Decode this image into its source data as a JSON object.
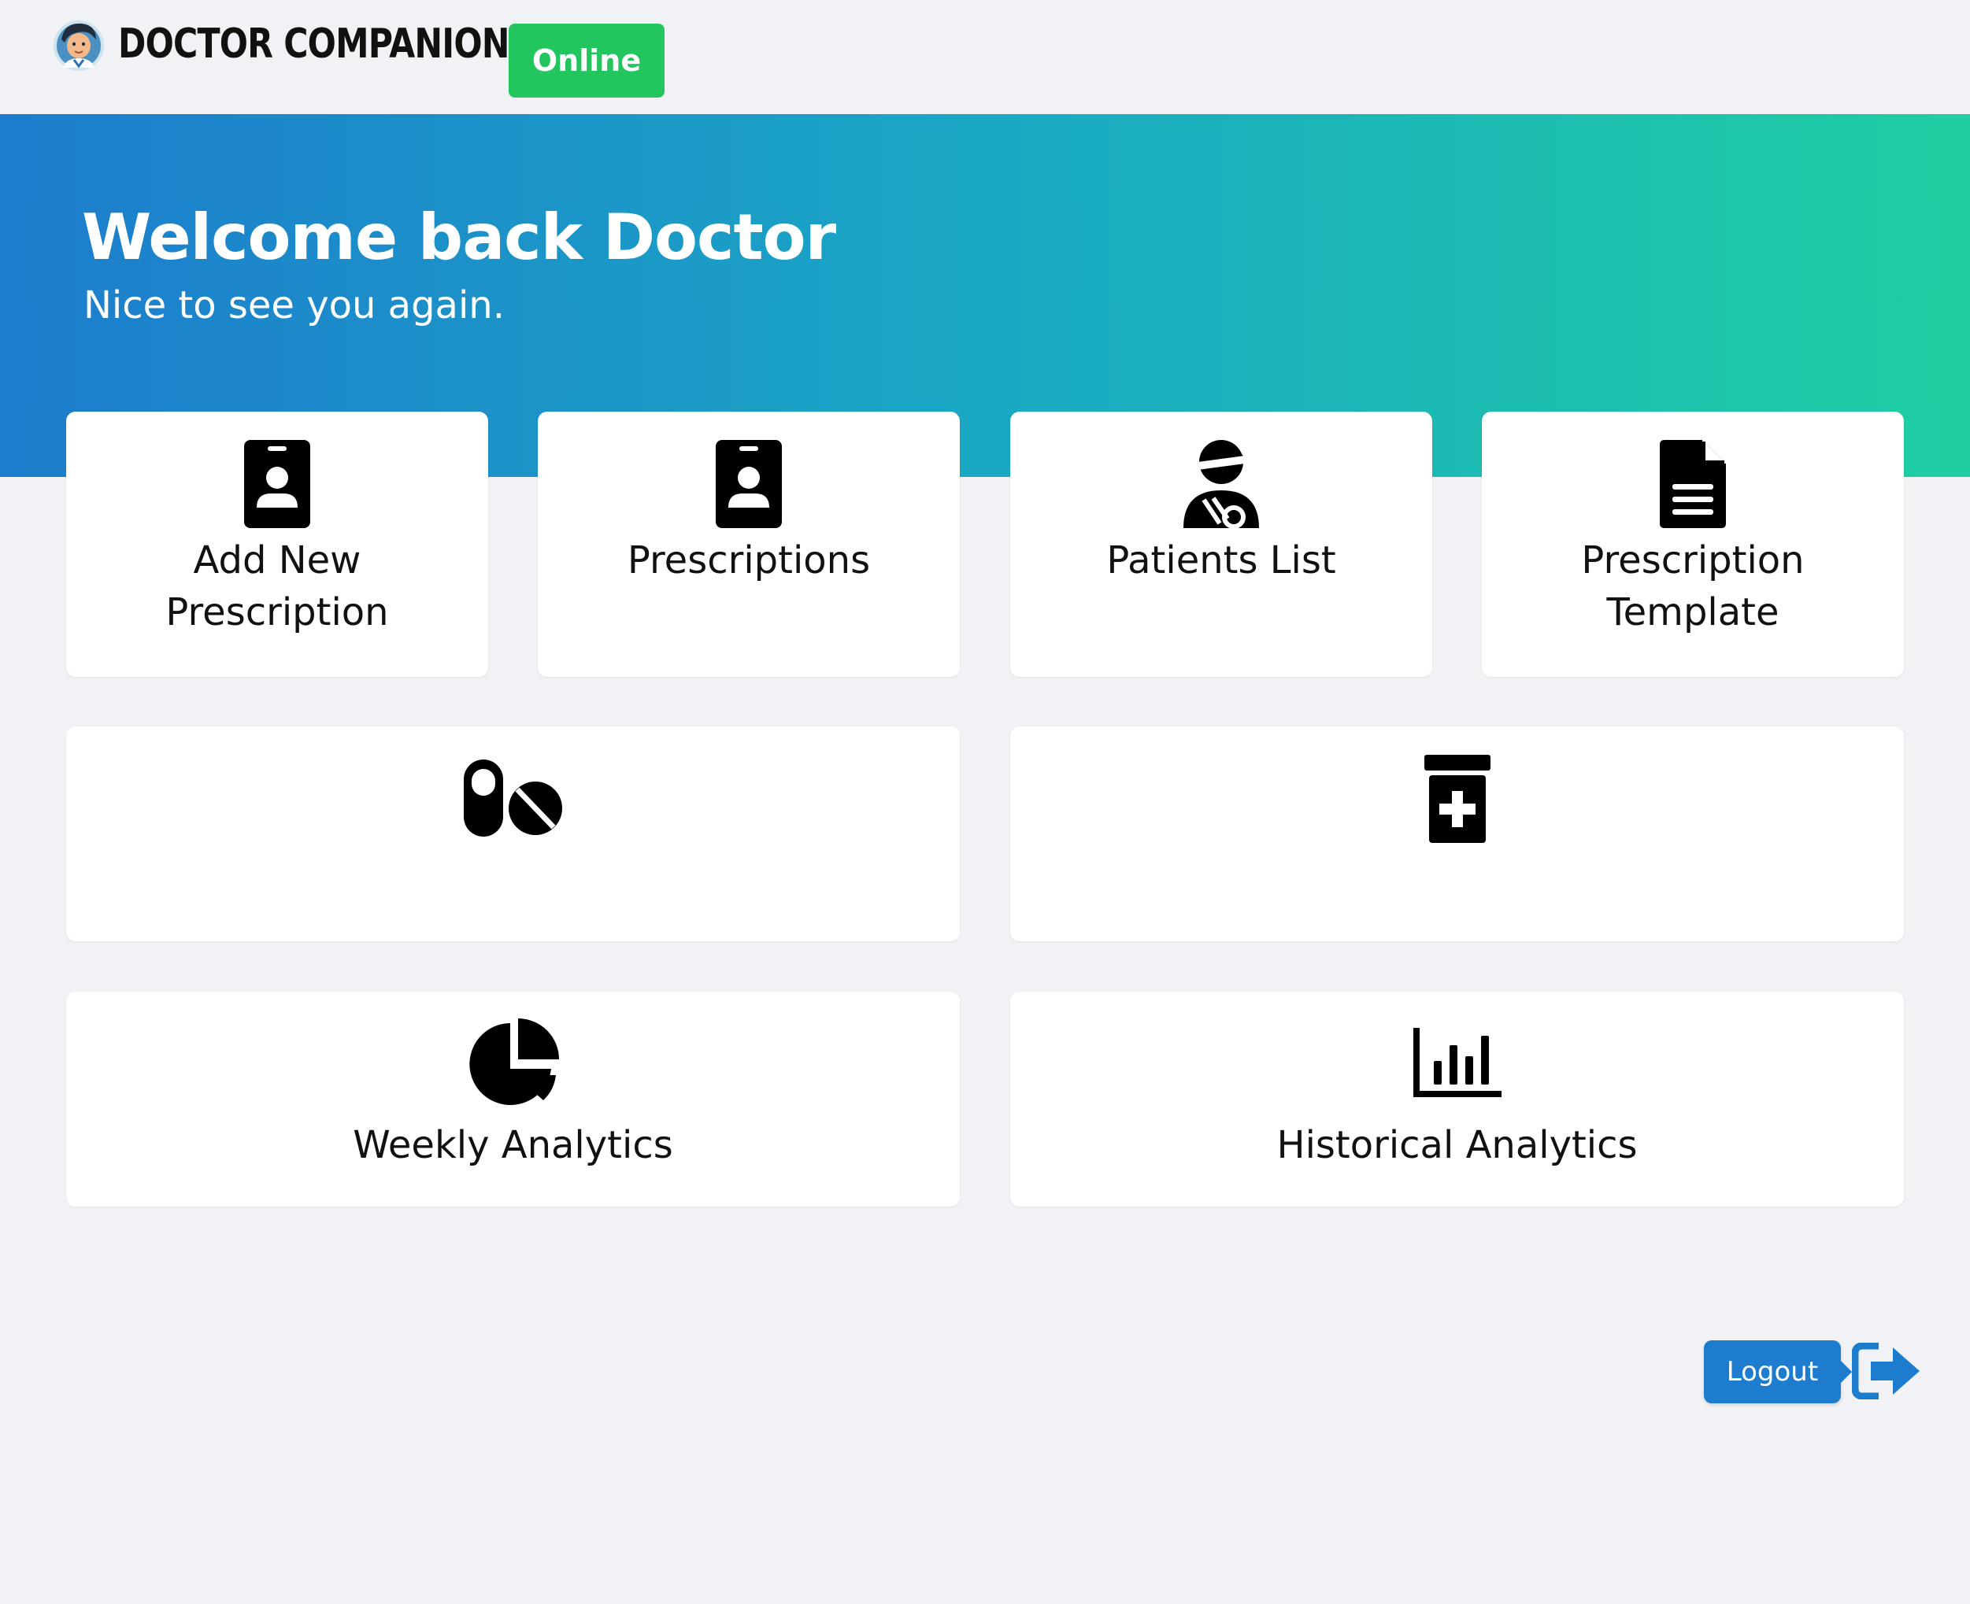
{
  "header": {
    "brand": "DOCTOR COMPANION",
    "status_badge": "Online",
    "status_color": "#22c55e"
  },
  "hero": {
    "title": "Welcome back Doctor",
    "subtitle": "Nice to see you again.",
    "gradient": [
      "#1d7ccd",
      "#1fcfa2"
    ]
  },
  "tiles": [
    {
      "label_lines": [
        "Add New",
        "Prescription"
      ],
      "icon": "id-badge-icon"
    },
    {
      "label_lines": [
        "Prescriptions"
      ],
      "icon": "id-badge-icon"
    },
    {
      "label_lines": [
        "Patients List"
      ],
      "icon": "user-injured-icon"
    },
    {
      "label_lines": [
        "Prescription",
        "Template"
      ],
      "icon": "file-lines-icon"
    },
    {
      "label_lines": [],
      "icon": "pills-icon"
    },
    {
      "label_lines": [],
      "icon": "prescription-bottle-medical-icon"
    },
    {
      "label_lines": [
        "Weekly Analytics"
      ],
      "icon": "chart-pie-icon"
    },
    {
      "label_lines": [
        "Historical Analytics"
      ],
      "icon": "chart-column-icon"
    }
  ],
  "logout": {
    "label": "Logout",
    "accent": "#1d7ccd",
    "icon": "sign-out-icon"
  }
}
